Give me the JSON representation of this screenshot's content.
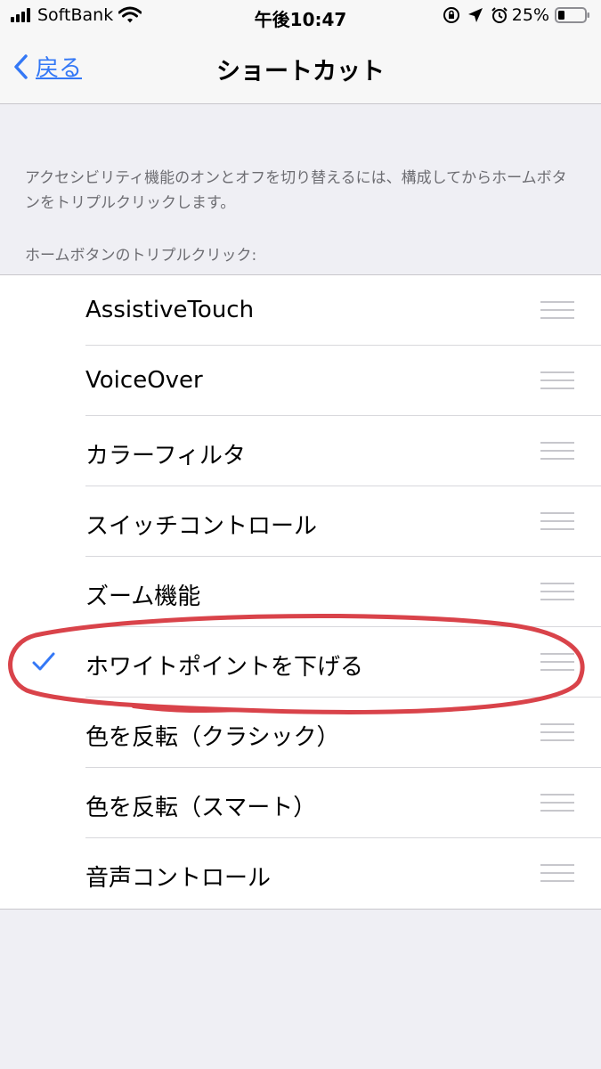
{
  "status_bar": {
    "carrier": "SoftBank",
    "time": "午後10:47",
    "battery": "25%",
    "icons": [
      "signal-icon",
      "wifi-icon",
      "orientation-lock-icon",
      "location-icon",
      "alarm-icon",
      "battery-icon"
    ]
  },
  "nav": {
    "back_label": "戻る",
    "title": "ショートカット"
  },
  "description": "アクセシビリティ機能のオンとオフを切り替えるには、構成してからホームボタンをトリプルクリックします。",
  "section_header": "ホームボタンのトリプルクリック:",
  "items": [
    {
      "label": "AssistiveTouch",
      "checked": false
    },
    {
      "label": "VoiceOver",
      "checked": false
    },
    {
      "label": "カラーフィルタ",
      "checked": false
    },
    {
      "label": "スイッチコントロール",
      "checked": false
    },
    {
      "label": "ズーム機能",
      "checked": false
    },
    {
      "label": "ホワイトポイントを下げる",
      "checked": true
    },
    {
      "label": "色を反転（クラシック）",
      "checked": false
    },
    {
      "label": "色を反転（スマート）",
      "checked": false
    },
    {
      "label": "音声コントロール",
      "checked": false
    }
  ],
  "colors": {
    "accent": "#3478f6",
    "annotation": "#d9434a",
    "background": "#efeff4"
  }
}
